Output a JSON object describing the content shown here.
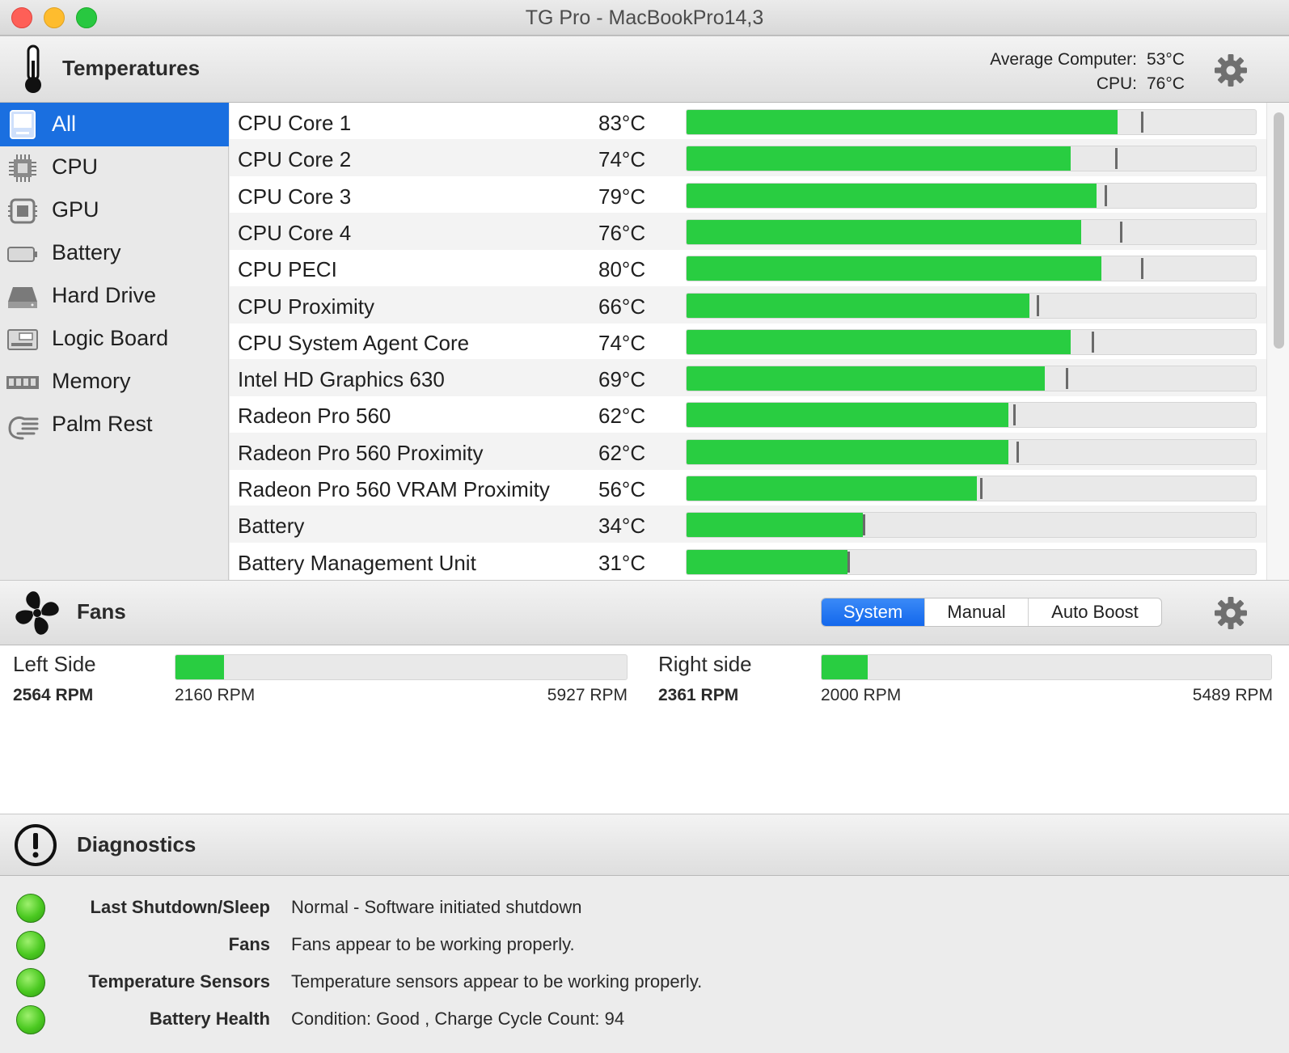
{
  "window": {
    "title": "TG Pro - MacBookPro14,3"
  },
  "temperatures": {
    "header": "Temperatures",
    "average_label": "Average Computer:",
    "average_value": "53°C",
    "cpu_label": "CPU:",
    "cpu_value": "76°C",
    "categories": [
      {
        "label": "All",
        "icon": "computer-icon",
        "selected": true
      },
      {
        "label": "CPU",
        "icon": "cpu-chip-icon"
      },
      {
        "label": "GPU",
        "icon": "gpu-chip-icon"
      },
      {
        "label": "Battery",
        "icon": "battery-icon"
      },
      {
        "label": "Hard Drive",
        "icon": "hard-drive-icon"
      },
      {
        "label": "Logic Board",
        "icon": "logic-board-icon"
      },
      {
        "label": "Memory",
        "icon": "memory-icon"
      },
      {
        "label": "Palm Rest",
        "icon": "palm-rest-icon"
      }
    ],
    "sensors": [
      {
        "name": "CPU Core 1",
        "temp": "83°C",
        "value": 83,
        "max": 87.5
      },
      {
        "name": "CPU Core 2",
        "temp": "74°C",
        "value": 74,
        "max": 82.5
      },
      {
        "name": "CPU Core 3",
        "temp": "79°C",
        "value": 79,
        "max": 80.5
      },
      {
        "name": "CPU Core 4",
        "temp": "76°C",
        "value": 76,
        "max": 83.5
      },
      {
        "name": "CPU PECI",
        "temp": "80°C",
        "value": 80,
        "max": 87.5
      },
      {
        "name": "CPU Proximity",
        "temp": "66°C",
        "value": 66,
        "max": 67.5
      },
      {
        "name": "CPU System Agent Core",
        "temp": "74°C",
        "value": 74,
        "max": 78
      },
      {
        "name": "Intel HD Graphics 630",
        "temp": "69°C",
        "value": 69,
        "max": 73
      },
      {
        "name": "Radeon Pro 560",
        "temp": "62°C",
        "value": 62,
        "max": 63
      },
      {
        "name": "Radeon Pro 560 Proximity",
        "temp": "62°C",
        "value": 62,
        "max": 63.5
      },
      {
        "name": "Radeon Pro 560 VRAM Proximity",
        "temp": "56°C",
        "value": 56,
        "max": 56.5
      },
      {
        "name": "Battery",
        "temp": "34°C",
        "value": 34,
        "max": 34
      },
      {
        "name": "Battery Management Unit",
        "temp": "31°C",
        "value": 31,
        "max": 31
      }
    ],
    "scale_max": 110
  },
  "fans": {
    "header": "Fans",
    "modes": [
      "System",
      "Manual",
      "Auto Boost"
    ],
    "selected_mode": "System",
    "left": {
      "name": "Left Side",
      "rpm": "2564 RPM",
      "min": "2160 RPM",
      "max": "5927 RPM",
      "fraction": 0.108
    },
    "right": {
      "name": "Right side",
      "rpm": "2361 RPM",
      "min": "2000 RPM",
      "max": "5489 RPM",
      "fraction": 0.103
    }
  },
  "diagnostics": {
    "header": "Diagnostics",
    "rows": [
      {
        "key": "Last Shutdown/Sleep",
        "value": "Normal - Software initiated shutdown",
        "status": "green"
      },
      {
        "key": "Fans",
        "value": "Fans appear to be working properly.",
        "status": "green"
      },
      {
        "key": "Temperature Sensors",
        "value": "Temperature sensors appear to be working properly.",
        "status": "green"
      },
      {
        "key": "Battery Health",
        "value": "Condition: Good , Charge Cycle Count: 94",
        "status": "green"
      }
    ]
  },
  "colors": {
    "accent": "#1a6fe0",
    "bar_fill": "#29cd41",
    "bar_track": "#e9e9e9"
  }
}
